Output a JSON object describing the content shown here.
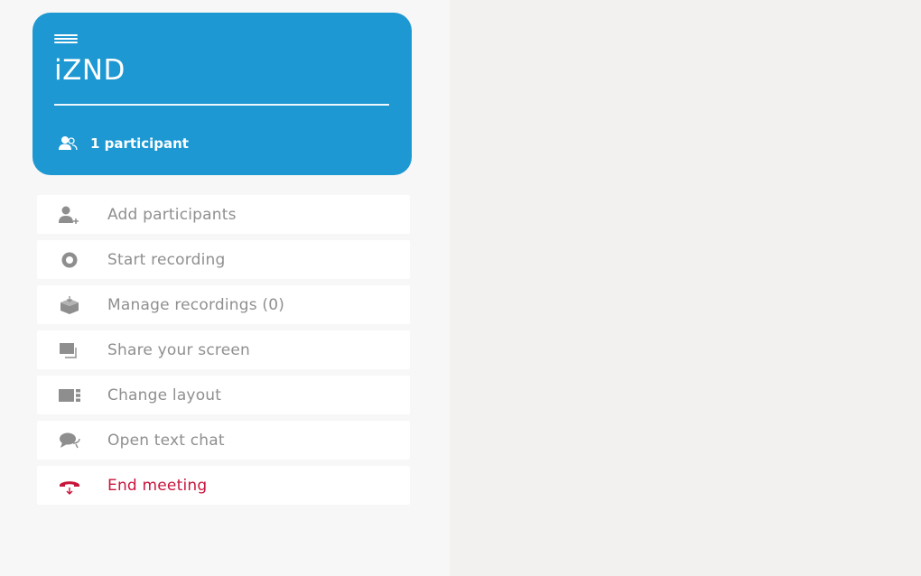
{
  "header": {
    "room_name": "iZND",
    "participants_label": "1 participant",
    "accent_color": "#1d98d2"
  },
  "menu": {
    "items": [
      {
        "label": "Add participants",
        "icon": "add-user-icon"
      },
      {
        "label": "Start recording",
        "icon": "record-icon"
      },
      {
        "label": "Manage recordings (0)",
        "icon": "recordings-box-icon"
      },
      {
        "label": "Share your screen",
        "icon": "screen-share-icon"
      },
      {
        "label": "Change layout",
        "icon": "layout-icon"
      },
      {
        "label": "Open text chat",
        "icon": "chat-icon"
      },
      {
        "label": "End meeting",
        "icon": "hangup-icon",
        "color": "#c8153c"
      }
    ]
  }
}
